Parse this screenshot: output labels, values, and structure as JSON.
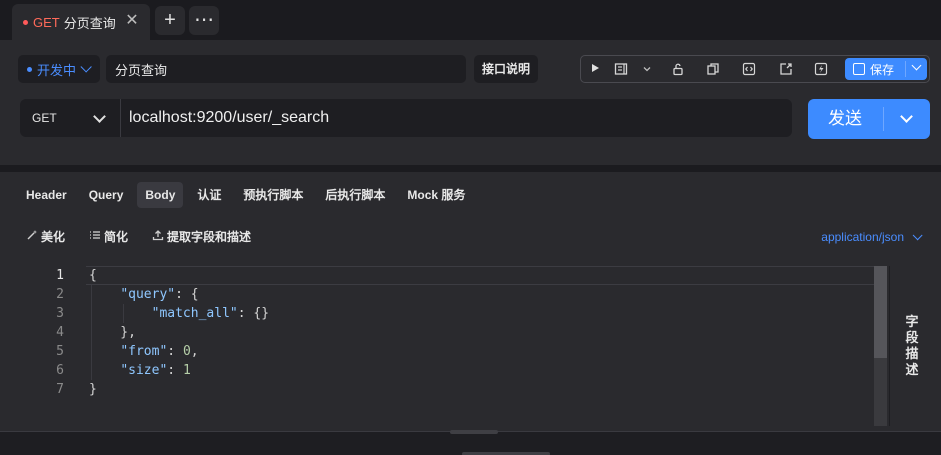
{
  "tab": {
    "method": "GET",
    "name": "分页查询",
    "close": "✕"
  },
  "tab_buttons": {
    "add": "+",
    "more": "⋯"
  },
  "env": {
    "label": "开发中"
  },
  "request": {
    "name": "分页查询",
    "doc_button": "接口说明",
    "method": "GET",
    "url": "localhost:9200/user/_search",
    "send": "发送"
  },
  "toolbar": {
    "save": "保存",
    "icons": [
      "play-icon",
      "doc-view-icon",
      "chevron-down-icon",
      "unlock-icon",
      "copy-icon",
      "code-icon",
      "share-icon",
      "flash-icon"
    ]
  },
  "body_tabs": [
    "Header",
    "Query",
    "Body",
    "认证",
    "预执行脚本",
    "后执行脚本",
    "Mock 服务"
  ],
  "active_body_tab": "Body",
  "actions": {
    "beautify": "美化",
    "simplify": "简化",
    "extract": "提取字段和描述"
  },
  "content_type": "application/json",
  "editor": {
    "line_numbers": [
      "1",
      "2",
      "3",
      "4",
      "5",
      "6",
      "7"
    ]
  },
  "side_panel": {
    "label": "字段描述"
  },
  "colors": {
    "accent": "#3d8bff",
    "get_method": "#ff6a5a",
    "json_key": "#8fc7ff",
    "json_number": "#b5cea8"
  }
}
